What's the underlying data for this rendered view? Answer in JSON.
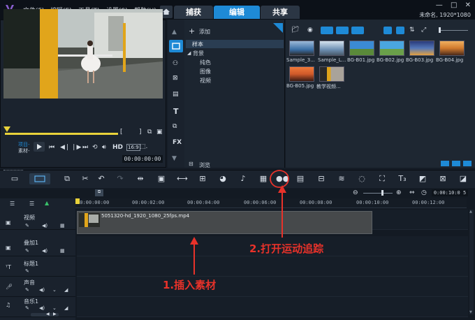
{
  "menu": [
    "文件(F)",
    "编辑(E)",
    "工具(T)",
    "设置(S)",
    "帮助(H)"
  ],
  "tabs": {
    "capture": "捕获",
    "edit": "编辑",
    "share": "共享"
  },
  "project_info": "未命名, 1920*1080",
  "preview": {
    "project_label": "项目-",
    "clip_label": "素材-",
    "hd": "HD",
    "timecode": "00:00:00:00"
  },
  "library": {
    "add_label": "添加",
    "tree": [
      "样本",
      "背景",
      "纯色",
      "图像",
      "视频"
    ],
    "browse_label": "浏览",
    "media": [
      {
        "label": "Sample_3...",
        "color": "#3a6ea5"
      },
      {
        "label": "Sample_L...",
        "color": "#6d8fb3"
      },
      {
        "label": "BG-B01.jpg",
        "color": "#3b8bd4"
      },
      {
        "label": "BG-B02.jpg",
        "color": "#4aa6e0"
      },
      {
        "label": "BG-B03.jpg",
        "color": "#5477b8"
      },
      {
        "label": "BG-B04.jpg",
        "color": "#d07a2e"
      },
      {
        "label": "BG-B05.jpg",
        "color": "#d05a2a"
      },
      {
        "label": "教学视频...",
        "color": "#7a6a55"
      }
    ]
  },
  "timeline": {
    "timecode": "0:00:10:0 5",
    "ruler": [
      "00:00:00:00",
      "00:00:02:00",
      "00:00:04:00",
      "00:00:06:00",
      "00:00:08:00",
      "00:00:10:00",
      "00:00:12:00"
    ],
    "tracks": [
      "视频",
      "叠加1",
      "标题1",
      "声音",
      "音乐1"
    ],
    "clip_name": "5051320-hd_1920_1080_25fps.mp4"
  },
  "annotations": {
    "insert": "1.插入素材",
    "motion": "2.打开运动追踪"
  },
  "colors": {
    "accent": "#1e8ad6",
    "annotation": "#e8322a",
    "scrub": "#e9d23a"
  }
}
